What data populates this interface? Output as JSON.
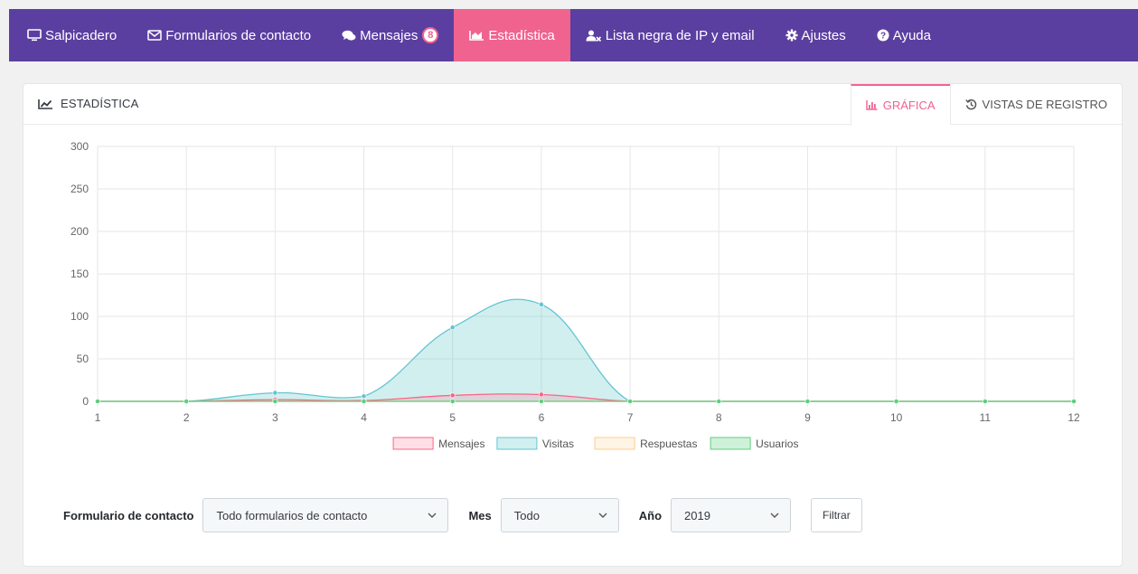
{
  "nav": {
    "items": [
      {
        "label": "Salpicadero",
        "icon": "desktop-icon"
      },
      {
        "label": "Formularios de contacto",
        "icon": "envelope-icon"
      },
      {
        "label": "Mensajes",
        "icon": "comments-icon",
        "badge": "8"
      },
      {
        "label": "Estadística",
        "icon": "area-chart-icon",
        "active": true
      },
      {
        "label": "Lista negra de IP y email",
        "icon": "user-block-icon"
      },
      {
        "label": "Ajustes",
        "icon": "gear-icon"
      },
      {
        "label": "Ayuda",
        "icon": "question-circle-icon"
      }
    ],
    "bg_color": "#5b3fa0",
    "active_color": "#f0638f"
  },
  "panel": {
    "title": "Estadística",
    "tabs": [
      {
        "label": "Gráfica",
        "icon": "bar-chart-icon",
        "active": true
      },
      {
        "label": "Vistas de registro",
        "icon": "history-icon"
      }
    ]
  },
  "chart_data": {
    "type": "area",
    "x": [
      1,
      2,
      3,
      4,
      5,
      6,
      7,
      8,
      9,
      10,
      11,
      12
    ],
    "ylim": [
      0,
      300
    ],
    "yticks": [
      0,
      50,
      100,
      150,
      200,
      250,
      300
    ],
    "grid": true,
    "legend_placement": "bottom-center",
    "series": [
      {
        "name": "Mensajes",
        "values": [
          0,
          0,
          2,
          1,
          7,
          8,
          0,
          0,
          0,
          0,
          0,
          0
        ],
        "color": "#ff6384",
        "fill": "rgba(255,99,132,0.2)"
      },
      {
        "name": "Visitas",
        "values": [
          0,
          0,
          10,
          6,
          87,
          114,
          0,
          0,
          0,
          0,
          0,
          0
        ],
        "color": "#63c5d3",
        "fill": "rgba(75,192,192,0.25)"
      },
      {
        "name": "Respuestas",
        "values": [
          0,
          0,
          0,
          0,
          0,
          0,
          0,
          0,
          0,
          0,
          0,
          0
        ],
        "color": "#ffcd86",
        "fill": "rgba(255,205,134,0.2)"
      },
      {
        "name": "Usuarios",
        "values": [
          0,
          0,
          0,
          0,
          0,
          0,
          0,
          0,
          0,
          0,
          0,
          0
        ],
        "color": "#5fcf80",
        "fill": "rgba(95,207,128,0.3)"
      }
    ]
  },
  "filters": {
    "form_label": "Formulario de contacto",
    "form_value": "Todo formularios de contacto",
    "month_label": "Mes",
    "month_value": "Todo",
    "year_label": "Año",
    "year_value": "2019",
    "filter_button": "Filtrar"
  }
}
